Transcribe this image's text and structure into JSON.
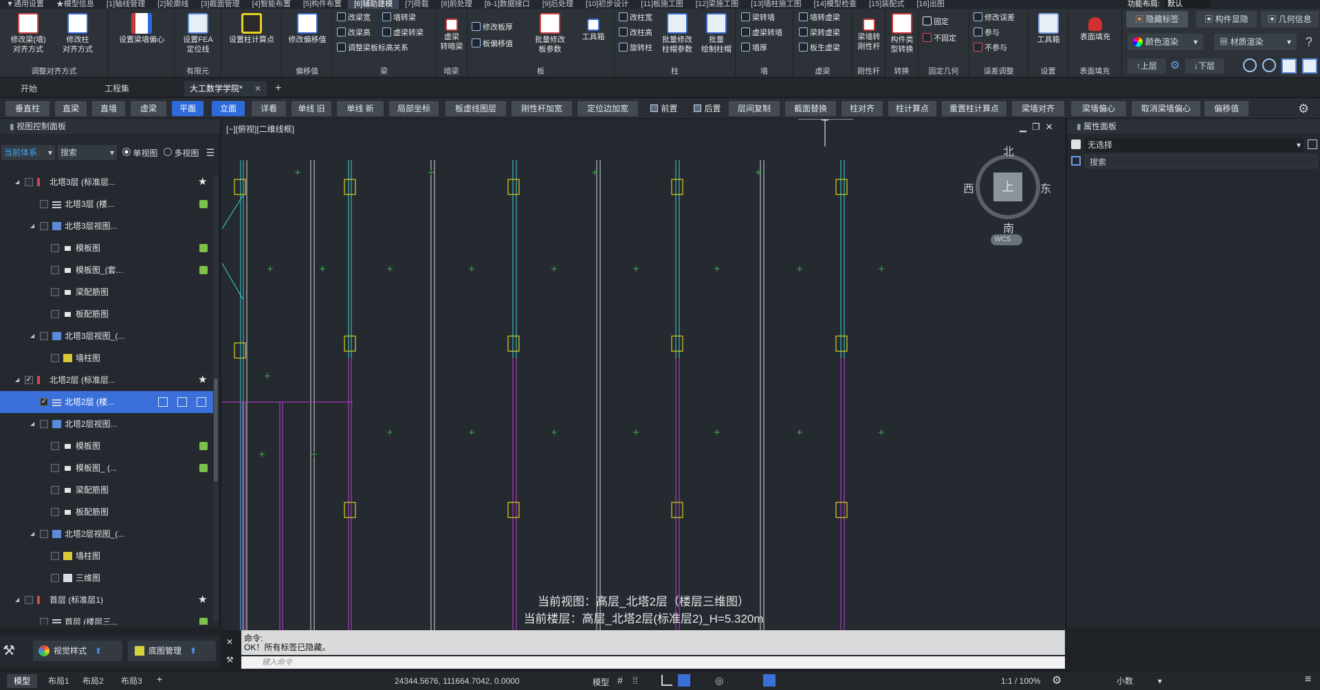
{
  "menubar": [
    "▼通用设置",
    "★模型信息",
    "[1]轴线管理",
    "[2]轮廓线",
    "[3]截面管理",
    "[4]智能布置",
    "[5]构件布置",
    "[6]辅助建模",
    "[7]荷载",
    "[8]前处理",
    "[8-1]数据接口",
    "[9]后处理",
    "[10]初步设计",
    "[11]板施工图",
    "[12]梁施工图",
    "[13]墙柱施工图",
    "[14]模型检查",
    "[15]装配式",
    "[16]出图"
  ],
  "menubar_right": {
    "layout_label": "功能布局:",
    "layout_value": "默认"
  },
  "ribbon": {
    "g1": {
      "b1": "修改梁(墙)\n对齐方式",
      "b2": "修改柱\n对齐方式",
      "label": "调整对齐方式"
    },
    "g2": {
      "b1": "设置梁墙偏心",
      "label": ""
    },
    "g3": {
      "b1": "设置FEA\n定位线",
      "label": "有限元"
    },
    "g4": {
      "b1": "设置柱计算点",
      "label": ""
    },
    "g5": {
      "b1": "修改偏移值",
      "label": "偏移值"
    },
    "g6": {
      "s1": "改梁宽",
      "s2": "墙转梁",
      "s3": "改梁高",
      "s4": "虚梁转梁",
      "s5": "调整梁板标高关系",
      "label": "梁"
    },
    "g7": {
      "b1": "虚梁\n转暗梁",
      "label": "暗梁"
    },
    "g8": {
      "s1": "修改板厚",
      "s2": "板偏移值",
      "b1": "批量修改\n板参数",
      "b2": "工具箱",
      "label": "板"
    },
    "g9": {
      "s1": "改柱宽",
      "s2": "改柱高",
      "s3": "旋转柱",
      "b1": "批量修改\n柱帽参数",
      "b2": "批量\n绘制柱帽",
      "label": "柱"
    },
    "g10": {
      "s1": "梁转墙",
      "s2": "虚梁转墙",
      "s3": "墙厚",
      "label": "墙"
    },
    "g11": {
      "s1": "墙转虚梁",
      "s2": "梁转虚梁",
      "s3": "板生虚梁",
      "label": "虚梁"
    },
    "g12": {
      "b1": "梁墙转\n刚性杆",
      "label": "刚性杆"
    },
    "g13": {
      "b1": "构件类\n型转换",
      "label": "转换"
    },
    "g14": {
      "s1": "固定",
      "s2": "不固定",
      "label": "固定几何"
    },
    "g15": {
      "s1": "修改误差",
      "s2": "参与",
      "s3": "不参与",
      "label": "误差调整"
    },
    "g16": {
      "b1": "工具箱",
      "label": "设置"
    },
    "g17": {
      "b1": "表面填充",
      "label": "表面填充"
    },
    "right": {
      "hide_tags": "隐藏标签",
      "comp_show": "构件显隐",
      "geo_info": "几何信息",
      "color_render": "颜色渲染",
      "material_render": "材质渲染",
      "up_floor": "上层",
      "down_floor": "下层",
      "help": "?"
    }
  },
  "tabs": {
    "start": "开始",
    "project": "工程集",
    "doc": "大工数学学院*"
  },
  "toolrow": [
    "垂直柱",
    "直梁",
    "直墙",
    "虚梁",
    "平面",
    "立面",
    "详看",
    "单线 旧",
    "单线 新",
    "局部坐标",
    "板虚线图层",
    "刚性杆加宽",
    "定位边加宽",
    "前置",
    "后置",
    "层间复制",
    "截面替换",
    "柱对齐",
    "柱计算点",
    "重置柱计算点",
    "梁墙对齐",
    "梁墙偏心",
    "取消梁墙偏心",
    "偏移值"
  ],
  "left_panel": {
    "title": "视图控制面板",
    "coord": "当前体系",
    "search": "搜索",
    "single": "单视图",
    "multi": "多视图",
    "tree": [
      {
        "label": "北塔3层 (标准层...",
        "indent": 1,
        "icon": "floor",
        "star": true
      },
      {
        "label": "北塔3层 (楼...",
        "indent": 2,
        "icon": "grid",
        "badge": true
      },
      {
        "label": "北塔3层视图...",
        "indent": 2,
        "icon": "view"
      },
      {
        "label": "模板图",
        "indent": 3,
        "icon": "sheet",
        "badge": true
      },
      {
        "label": "模板图_(套...",
        "indent": 3,
        "icon": "sheet",
        "badge": true
      },
      {
        "label": "梁配筋图",
        "indent": 3,
        "icon": "sheet"
      },
      {
        "label": "板配筋图",
        "indent": 3,
        "icon": "sheet"
      },
      {
        "label": "北塔3层视图_(...",
        "indent": 2,
        "icon": "view"
      },
      {
        "label": "墙柱图",
        "indent": 3,
        "icon": "yellow"
      },
      {
        "label": "北塔2层 (标准层...",
        "indent": 1,
        "icon": "floor",
        "star": true,
        "checked": true
      },
      {
        "label": "北塔2层 (楼...",
        "indent": 2,
        "icon": "grid",
        "selected": true,
        "checked": true
      },
      {
        "label": "北塔2层视图...",
        "indent": 2,
        "icon": "view"
      },
      {
        "label": "模板图",
        "indent": 3,
        "icon": "sheet",
        "badge": true
      },
      {
        "label": "模板图_ (...",
        "indent": 3,
        "icon": "sheet",
        "badge": true
      },
      {
        "label": "梁配筋图",
        "indent": 3,
        "icon": "sheet"
      },
      {
        "label": "板配筋图",
        "indent": 3,
        "icon": "sheet"
      },
      {
        "label": "北塔2层视图_(...",
        "indent": 2,
        "icon": "view"
      },
      {
        "label": "墙柱图",
        "indent": 3,
        "icon": "yellow"
      },
      {
        "label": "三维图",
        "indent": 3,
        "icon": "cube"
      },
      {
        "label": "首层 (标准层1)",
        "indent": 1,
        "icon": "floor",
        "star": true
      },
      {
        "label": "首层 (楼层三...",
        "indent": 2,
        "icon": "grid",
        "badge": true
      }
    ],
    "view_style": "视觉样式",
    "base_mgmt": "底图管理"
  },
  "canvas": {
    "view_label": "[−][俯视][二维线框]",
    "compass": {
      "n": "北",
      "s": "南",
      "e": "东",
      "w": "西",
      "center": "上",
      "wcs": "WCS"
    },
    "info1": "当前视图：高层_北塔2层（楼层三维图）",
    "info2": "当前楼层：高层_北塔2层(标准层2)_H=5.320m"
  },
  "right_panel": {
    "title": "属性面板",
    "select": "无选择",
    "search": "搜索"
  },
  "command": {
    "line1": "命令:",
    "line2": "OK！所有标签已隐藏。",
    "placeholder": "键入命令"
  },
  "status": {
    "tabs": [
      "模型",
      "布局1",
      "布局2",
      "布局3"
    ],
    "coords": "24344.5676, 111664.7042, 0.0000",
    "model": "模型",
    "scale": "1:1 / 100%",
    "decimal": "小数"
  },
  "colors": {
    "accent": "#2f6bd8",
    "cyan": "#3ed5d5",
    "magenta": "#c53fd8",
    "yellow": "#d8d21a",
    "white_line": "#d8dde0",
    "green_cross": "#3fb84a"
  }
}
